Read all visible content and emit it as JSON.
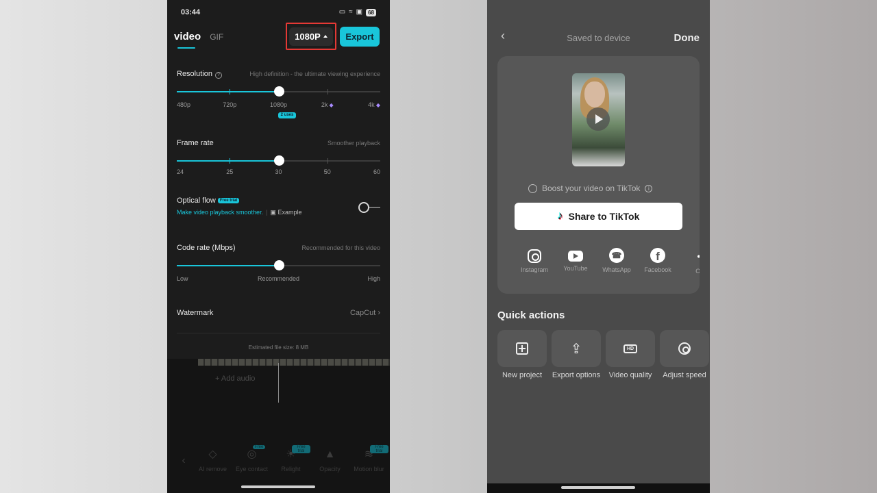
{
  "left": {
    "status": {
      "time": "03:44",
      "battery": "68"
    },
    "tabs": {
      "video": "video",
      "gif": "GIF"
    },
    "resolution_button": "1080P",
    "export_button": "Export",
    "resolution": {
      "label": "Resolution",
      "hint": "High definition - the ultimate viewing experience",
      "ticks": [
        "480p",
        "720p",
        "1080p",
        "2k",
        "4k"
      ],
      "selected": "1080p",
      "selected_index": 2,
      "uses_badge": "2 uses"
    },
    "frame_rate": {
      "label": "Frame rate",
      "hint": "Smoother playback",
      "ticks": [
        "24",
        "25",
        "30",
        "50",
        "60"
      ],
      "selected": "30",
      "selected_index": 2
    },
    "optical_flow": {
      "label": "Optical flow",
      "badge": "Free trial",
      "subtitle": "Make video playback smoother.",
      "example": "Example",
      "enabled": false
    },
    "code_rate": {
      "label": "Code rate (Mbps)",
      "hint": "Recommended for this video",
      "ticks": [
        "Low",
        "Recommended",
        "High"
      ],
      "selected": "Recommended",
      "selected_index": 1
    },
    "watermark": {
      "label": "Watermark",
      "value": "CapCut"
    },
    "file_size": "Estimated file size: 8 MB",
    "add_audio": "+ Add audio",
    "tools": [
      {
        "label": "AI remove",
        "icon": "eraser-icon",
        "badge": ""
      },
      {
        "label": "Eye contact",
        "icon": "eye-icon",
        "badge": "Free"
      },
      {
        "label": "Relight",
        "icon": "relight-icon",
        "badge": "Free trial"
      },
      {
        "label": "Opacity",
        "icon": "drop-icon",
        "badge": ""
      },
      {
        "label": "Motion blur",
        "icon": "motion-icon",
        "badge": "Free trial"
      }
    ],
    "colors": {
      "accent": "#19c6da",
      "highlight": "#e53935",
      "panel": "#1c1c1c"
    }
  },
  "right": {
    "title": "Saved to device",
    "done": "Done",
    "boost": "Boost your video on TikTok",
    "share_button": "Share to TikTok",
    "social": [
      {
        "label": "Instagram",
        "icon": "instagram-icon"
      },
      {
        "label": "YouTube",
        "icon": "youtube-icon"
      },
      {
        "label": "WhatsApp",
        "icon": "whatsapp-icon"
      },
      {
        "label": "Facebook",
        "icon": "facebook-icon"
      },
      {
        "label": "Ot",
        "icon": "more-icon"
      }
    ],
    "quick_actions_title": "Quick actions",
    "quick_actions": [
      {
        "label": "New project",
        "icon": "new-project-icon"
      },
      {
        "label": "Export options",
        "icon": "upload-icon"
      },
      {
        "label": "Video quality",
        "icon": "hd-icon"
      },
      {
        "label": "Adjust speed",
        "icon": "speed-icon"
      }
    ],
    "colors": {
      "background": "#4a4a4a",
      "card": "#575757"
    }
  }
}
